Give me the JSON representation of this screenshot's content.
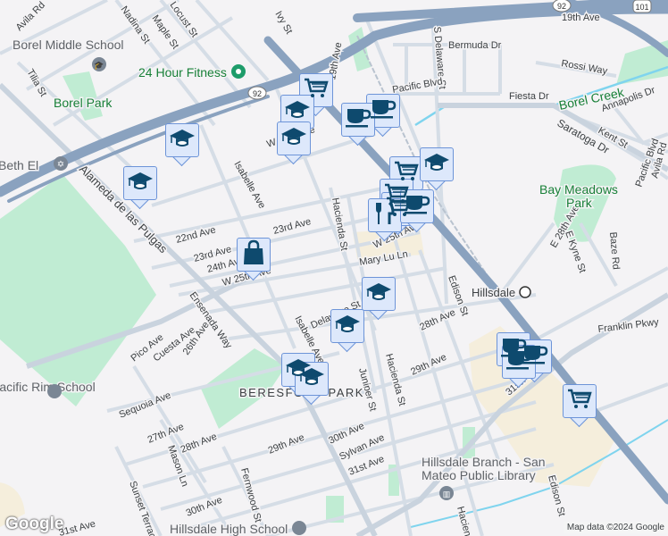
{
  "streets": [
    "Avila Rd",
    "Nadina St",
    "Maple St",
    "Locust St",
    "Ivy St",
    "19th Ave",
    "Tilia St",
    "W 20th Ave",
    "Isabelle Ave",
    "22nd Ave",
    "23rd Ave",
    "23rd Ave",
    "24th Ave",
    "W 25th Ave",
    "Alameda de las Pulgas",
    "Ensenada Way",
    "Pico Ave",
    "Cuesta Ave",
    "26th Ave",
    "Sequoia Ave",
    "27th Ave",
    "28th Ave",
    "Mason Ln",
    "29th Ave",
    "30th Ave",
    "Fernwood St",
    "Sunset Terrace",
    "31st Ave",
    "Hacienda St",
    "Mary Lu Ln",
    "W 25th Ave",
    "Delaware St",
    "Isabelle Ave",
    "Juniper St",
    "Hacienda St",
    "Edison St",
    "28th Ave",
    "29th Ave",
    "30th Ave",
    "Sylvan Ave",
    "31st Ave",
    "S Delaware St",
    "Bermuda Dr",
    "Rossi Way",
    "Fiesta Dr",
    "Pacific Blvd",
    "19th Ave",
    "Annapolis Dr",
    "Saratoga Dr",
    "Kent St",
    "E 28th Ave",
    "E Kyne St",
    "Baze Rd",
    "Franklin Pkwy",
    "31st Ave",
    "Edison St",
    "Hacienda St",
    "Pacific Blvd",
    "Avila Rd"
  ],
  "pois": {
    "borel_school": "Borel Middle School",
    "fitness": "24 Hour Fitness",
    "beth_el": "Beth El",
    "pacific_rim": "Pacific Rim School",
    "hillsdale_hs": "Hillsdale High School",
    "library_1": "Hillsdale Branch - San",
    "library_2": "Mateo Public Library",
    "hillsdale": "Hillsdale"
  },
  "parks": {
    "borel_park": "Borel Park",
    "bay_meadows_1": "Bay Meadows",
    "bay_meadows_2": "Park",
    "borel_creek": "Borel Creek"
  },
  "area": "BERESFORD PARK",
  "shields": {
    "sr92": "92",
    "sr92b": "92",
    "us101": "101"
  },
  "markers": [
    "grocery",
    "school",
    "school",
    "coffee",
    "coffee",
    "school",
    "school",
    "grocery",
    "school",
    "grocery",
    "grocery",
    "restaurant",
    "coffee",
    "shopping",
    "school",
    "school",
    "school",
    "school",
    "coffee",
    "coffee",
    "coffee",
    "grocery"
  ],
  "attribution": "Map data ©2024 Google",
  "logo": "Google",
  "colors": {
    "highway": "#8aa2bf",
    "road": "#d5dde6",
    "park": "#c0ecd3",
    "water": "#7fd4ee",
    "commercial": "#f5eedc",
    "marker_icon": "#0e4a6e"
  }
}
